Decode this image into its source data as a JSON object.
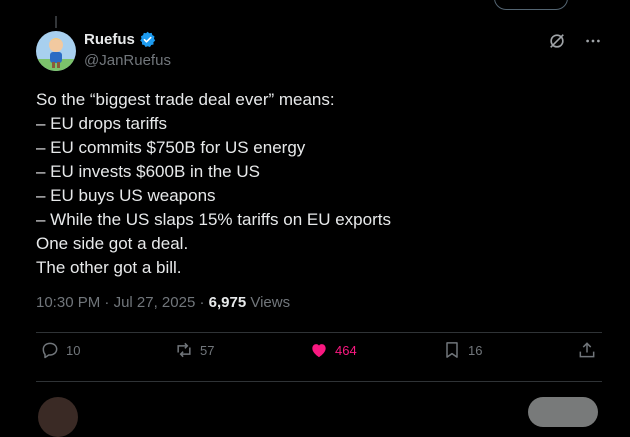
{
  "author": {
    "name": "Ruefus",
    "handle": "@JanRuefus"
  },
  "tweet": {
    "lines": [
      "So the “biggest trade deal ever” means:",
      "– EU drops tariffs",
      "– EU commits $750B for US energy",
      "– EU invests $600B in the US",
      "– EU buys US weapons",
      "– While the US slaps 15% tariffs on EU exports",
      "One side got a deal.",
      "The other got a bill."
    ],
    "time": "10:30 PM",
    "separator": "·",
    "date": "Jul 27, 2025",
    "views_count": "6,975",
    "views_label": "Views"
  },
  "actions": {
    "replies": "10",
    "reposts": "57",
    "likes": "464",
    "bookmarks": "16"
  },
  "colors": {
    "like_active": "#f91880",
    "verified": "#1d9bf0",
    "muted": "#71767b"
  },
  "icons": [
    "verified-badge-icon",
    "grok-icon",
    "more-icon",
    "reply-icon",
    "repost-icon",
    "like-icon",
    "bookmark-icon",
    "share-icon"
  ]
}
